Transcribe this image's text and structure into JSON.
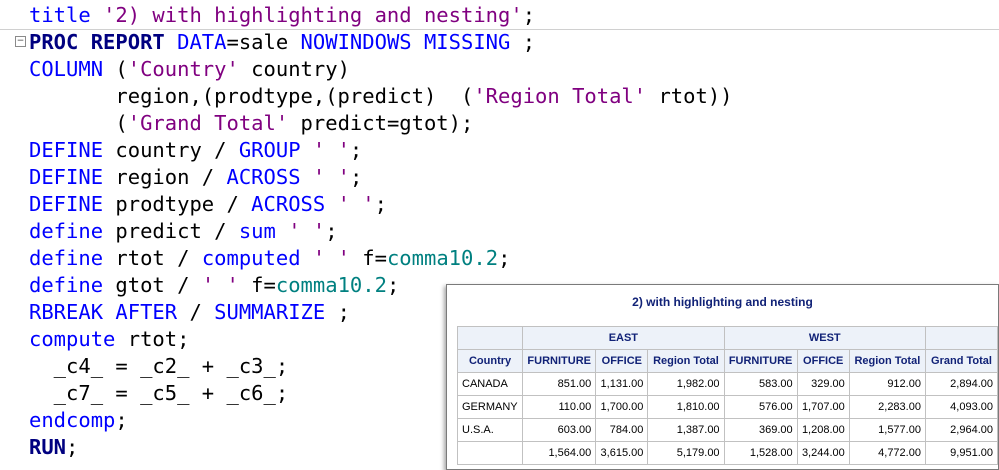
{
  "code": {
    "lines": [
      {
        "segments": [
          {
            "t": "title ",
            "c": "kw"
          },
          {
            "t": "'2) with highlighting and nesting'",
            "c": "str"
          },
          {
            "t": ";",
            "c": "plain"
          }
        ]
      },
      {
        "segments": [
          {
            "t": "PROC REPORT ",
            "c": "kwb"
          },
          {
            "t": "DATA",
            "c": "kw"
          },
          {
            "t": "=sale ",
            "c": "plain"
          },
          {
            "t": "NOWINDOWS MISSING ",
            "c": "kw"
          },
          {
            "t": ";",
            "c": "plain"
          }
        ]
      },
      {
        "segments": [
          {
            "t": "COLUMN ",
            "c": "kw"
          },
          {
            "t": "(",
            "c": "plain"
          },
          {
            "t": "'Country'",
            "c": "str"
          },
          {
            "t": " country)",
            "c": "plain"
          }
        ]
      },
      {
        "segments": [
          {
            "t": "       region,(prodtype,(predict)  (",
            "c": "plain"
          },
          {
            "t": "'Region Total'",
            "c": "str"
          },
          {
            "t": " rtot))",
            "c": "plain"
          }
        ]
      },
      {
        "segments": [
          {
            "t": "       (",
            "c": "plain"
          },
          {
            "t": "'Grand Total'",
            "c": "str"
          },
          {
            "t": " predict=gtot);",
            "c": "plain"
          }
        ]
      },
      {
        "segments": [
          {
            "t": "DEFINE ",
            "c": "kw"
          },
          {
            "t": "country / ",
            "c": "plain"
          },
          {
            "t": "GROUP ",
            "c": "kw"
          },
          {
            "t": "' '",
            "c": "str"
          },
          {
            "t": ";",
            "c": "plain"
          }
        ]
      },
      {
        "segments": [
          {
            "t": "DEFINE ",
            "c": "kw"
          },
          {
            "t": "region / ",
            "c": "plain"
          },
          {
            "t": "ACROSS ",
            "c": "kw"
          },
          {
            "t": "' '",
            "c": "str"
          },
          {
            "t": ";",
            "c": "plain"
          }
        ]
      },
      {
        "segments": [
          {
            "t": "DEFINE ",
            "c": "kw"
          },
          {
            "t": "prodtype / ",
            "c": "plain"
          },
          {
            "t": "ACROSS ",
            "c": "kw"
          },
          {
            "t": "' '",
            "c": "str"
          },
          {
            "t": ";",
            "c": "plain"
          }
        ]
      },
      {
        "segments": [
          {
            "t": "define ",
            "c": "kw"
          },
          {
            "t": "predict / ",
            "c": "plain"
          },
          {
            "t": "sum ",
            "c": "kw"
          },
          {
            "t": "' '",
            "c": "str"
          },
          {
            "t": ";",
            "c": "plain"
          }
        ]
      },
      {
        "segments": [
          {
            "t": "define ",
            "c": "kw"
          },
          {
            "t": "rtot / ",
            "c": "plain"
          },
          {
            "t": "computed ",
            "c": "kw"
          },
          {
            "t": "' '",
            "c": "str"
          },
          {
            "t": " f=",
            "c": "plain"
          },
          {
            "t": "comma10.2",
            "c": "fmt"
          },
          {
            "t": ";",
            "c": "plain"
          }
        ]
      },
      {
        "segments": [
          {
            "t": "define ",
            "c": "kw"
          },
          {
            "t": "gtot / ",
            "c": "plain"
          },
          {
            "t": "' '",
            "c": "str"
          },
          {
            "t": " f=",
            "c": "plain"
          },
          {
            "t": "comma10.2",
            "c": "fmt"
          },
          {
            "t": ";",
            "c": "plain"
          }
        ]
      },
      {
        "segments": [
          {
            "t": "RBREAK AFTER ",
            "c": "kw"
          },
          {
            "t": "/ ",
            "c": "plain"
          },
          {
            "t": "SUMMARIZE ",
            "c": "kw"
          },
          {
            "t": ";",
            "c": "plain"
          }
        ]
      },
      {
        "segments": [
          {
            "t": "compute ",
            "c": "kw"
          },
          {
            "t": "rtot;",
            "c": "plain"
          }
        ]
      },
      {
        "segments": [
          {
            "t": "  _c4_ = _c2_ + _c3_;",
            "c": "plain"
          }
        ]
      },
      {
        "segments": [
          {
            "t": "  _c7_ = _c5_ + _c6_;",
            "c": "plain"
          }
        ]
      },
      {
        "segments": [
          {
            "t": "endcomp",
            "c": "kw"
          },
          {
            "t": ";",
            "c": "plain"
          }
        ]
      },
      {
        "segments": [
          {
            "t": "RUN",
            "c": "kwb"
          },
          {
            "t": ";",
            "c": "plain"
          }
        ]
      }
    ],
    "fold_icon": "minus-box-icon"
  },
  "output": {
    "title": "2) with highlighting and nesting",
    "header_top": {
      "east": "EAST",
      "west": "WEST"
    },
    "columns": [
      "Country",
      "FURNITURE",
      "OFFICE",
      "Region Total",
      "FURNITURE",
      "OFFICE",
      "Region Total",
      "Grand Total"
    ],
    "rows": [
      [
        "CANADA",
        "851.00",
        "1,131.00",
        "1,982.00",
        "583.00",
        "329.00",
        "912.00",
        "2,894.00"
      ],
      [
        "GERMANY",
        "110.00",
        "1,700.00",
        "1,810.00",
        "576.00",
        "1,707.00",
        "2,283.00",
        "4,093.00"
      ],
      [
        "U.S.A.",
        "603.00",
        "784.00",
        "1,387.00",
        "369.00",
        "1,208.00",
        "1,577.00",
        "2,964.00"
      ],
      [
        "",
        "1,564.00",
        "3,615.00",
        "5,179.00",
        "1,528.00",
        "3,244.00",
        "4,772.00",
        "9,951.00"
      ]
    ]
  }
}
